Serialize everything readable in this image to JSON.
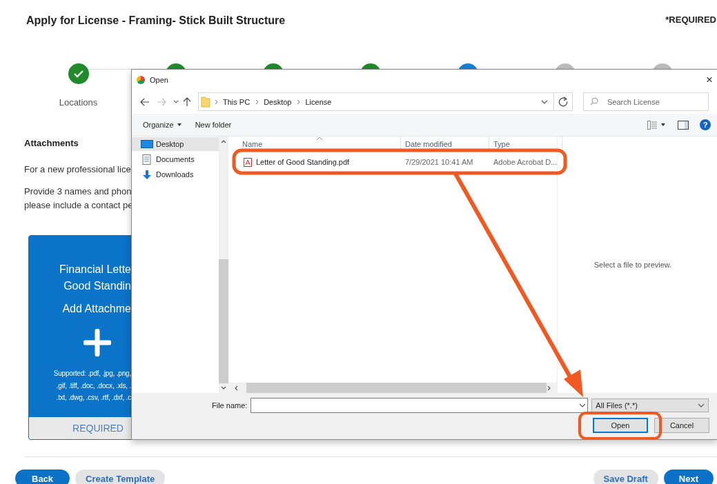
{
  "page": {
    "title": "Apply for License - Framing- Stick Built Structure",
    "required_note": "*REQUIRED"
  },
  "steps": [
    {
      "label": "Locations",
      "completed": true,
      "current": false
    },
    {
      "completed": true,
      "current": false
    },
    {
      "completed": true,
      "current": false
    },
    {
      "completed": true,
      "current": false
    },
    {
      "completed": false,
      "current": true
    },
    {
      "completed": false,
      "current": false
    },
    {
      "completed": false,
      "current": false
    }
  ],
  "attachments": {
    "heading": "Attachments",
    "paragraphs": [
      [
        "For a new professional lice"
      ],
      [
        "Provide 3 names and phon",
        "please include a contact pe"
      ]
    ],
    "card": {
      "title_lines": [
        "Financial Lette",
        "Good Standin"
      ],
      "action": "Add Attachme",
      "supported_lines": [
        "Supported: .pdf, .jpg, .png,",
        ".gif, .tiff, .doc, .docx, .xls, .",
        ".txt, .dwg, .csv, .rtf, .dxf, .c"
      ],
      "footer": "REQUIRED"
    }
  },
  "dialog": {
    "title": "Open",
    "close": "×",
    "path": [
      "This PC",
      "Desktop",
      "License"
    ],
    "search": {
      "placeholder": "Search License"
    },
    "toolbar": {
      "organize": "Organize",
      "new_folder": "New folder",
      "help": "?"
    },
    "nav": [
      {
        "label": "Desktop",
        "kind": "desktop",
        "selected": true
      },
      {
        "label": "Documents",
        "kind": "documents",
        "selected": false
      },
      {
        "label": "Downloads",
        "kind": "downloads",
        "selected": false
      }
    ],
    "columns": [
      "Name",
      "Date modified",
      "Type"
    ],
    "files": [
      {
        "name": "Letter of Good Standing.pdf",
        "date": "7/29/2021 10:41 AM",
        "type": "Adobe Acrobat D..."
      }
    ],
    "preview": "Select a file to preview.",
    "file_name": {
      "label": "File name:"
    },
    "filter": "All Files (*.*)",
    "buttons": [
      {
        "label": "Open",
        "default": true
      },
      {
        "label": "Cancel",
        "default": false
      }
    ]
  },
  "footer": {
    "left": [
      {
        "label": "Back",
        "kind": "primary"
      },
      {
        "label": "Create Template",
        "kind": "secondary"
      }
    ],
    "right": [
      {
        "label": "Save Draft",
        "kind": "secondary"
      },
      {
        "label": "Next",
        "kind": "primary"
      }
    ]
  }
}
